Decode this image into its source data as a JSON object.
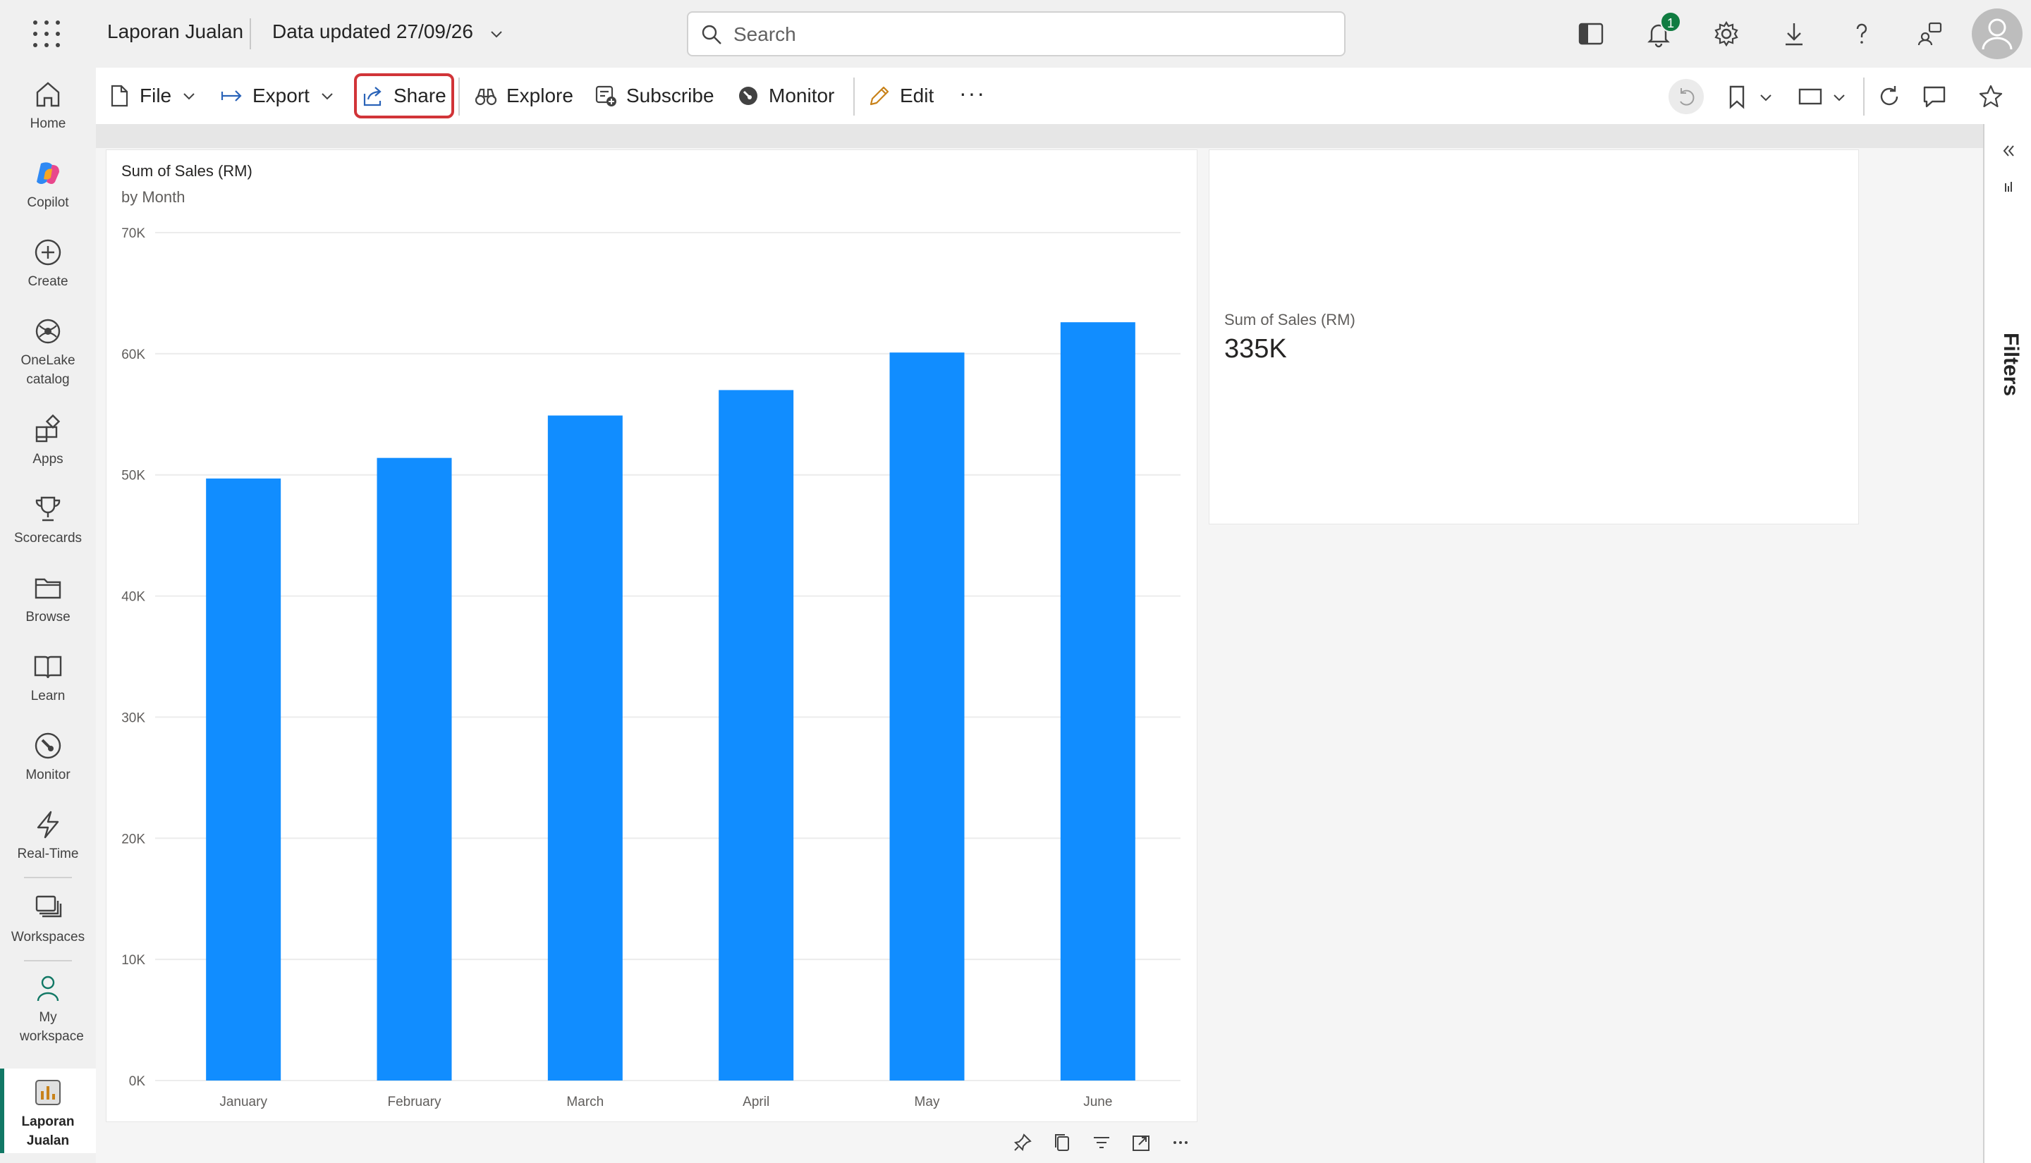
{
  "header": {
    "app_title": "Laporan Jualan",
    "data_updated": "Data updated 27/09/26",
    "search_placeholder": "Search",
    "notification_count": "1"
  },
  "rail": {
    "items": [
      {
        "label": "Home",
        "icon": "home-icon"
      },
      {
        "label": "Copilot",
        "icon": "copilot-icon"
      },
      {
        "label": "Create",
        "icon": "create-icon"
      },
      {
        "label": "OneLake catalog",
        "icon": "onelake-icon"
      },
      {
        "label": "Apps",
        "icon": "apps-icon"
      },
      {
        "label": "Scorecards",
        "icon": "trophy-icon"
      },
      {
        "label": "Browse",
        "icon": "folder-icon"
      },
      {
        "label": "Learn",
        "icon": "book-icon"
      },
      {
        "label": "Monitor",
        "icon": "monitor-icon"
      },
      {
        "label": "Real-Time",
        "icon": "lightning-icon"
      },
      {
        "label": "Workspaces",
        "icon": "workspaces-icon"
      },
      {
        "label": "My workspace",
        "icon": "person-icon"
      },
      {
        "label": "Laporan Jualan",
        "icon": "report-icon"
      }
    ]
  },
  "toolbar": {
    "file": "File",
    "export": "Export",
    "share": "Share",
    "explore": "Explore",
    "subscribe": "Subscribe",
    "monitor": "Monitor",
    "edit": "Edit",
    "more": "···"
  },
  "card": {
    "label": "Sum of Sales (RM)",
    "value": "335K"
  },
  "filters": {
    "label": "Filters"
  },
  "colors": {
    "bar": "#118dff",
    "accent": "#117865",
    "share_highlight": "#d13438"
  },
  "chart_data": {
    "type": "bar",
    "title": "Sum of Sales (RM)",
    "subtitle": "by Month",
    "categories": [
      "January",
      "February",
      "March",
      "April",
      "May",
      "June"
    ],
    "values": [
      49700,
      51400,
      54900,
      57000,
      60100,
      62600
    ],
    "ylim": [
      0,
      70000
    ],
    "yticks": [
      0,
      10000,
      20000,
      30000,
      40000,
      50000,
      60000,
      70000
    ],
    "ytick_labels": [
      "0K",
      "10K",
      "20K",
      "30K",
      "40K",
      "50K",
      "60K",
      "70K"
    ],
    "grid": true
  }
}
